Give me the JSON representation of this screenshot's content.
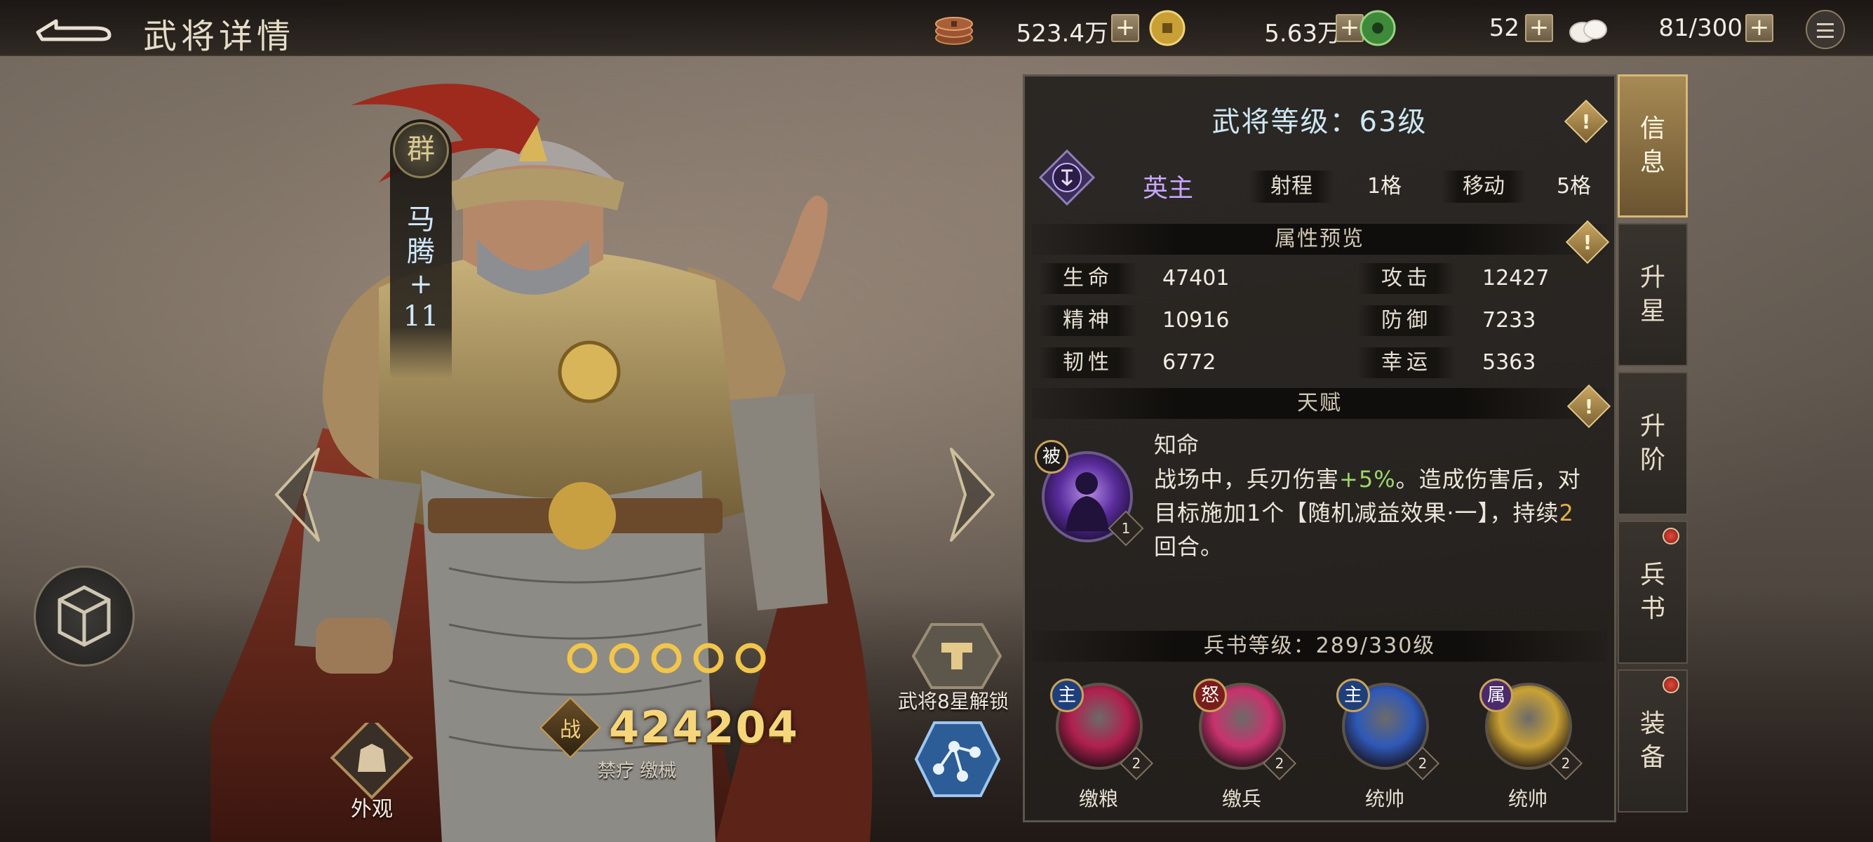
{
  "header": {
    "title": "武将详情"
  },
  "resources": [
    {
      "name": "copper-coins",
      "icon": "copper-coin-stack-icon",
      "value": "523.4万"
    },
    {
      "name": "gold-coin",
      "icon": "gold-coin-icon",
      "value": "5.63万"
    },
    {
      "name": "jade",
      "icon": "jade-coin-icon",
      "value": "52"
    },
    {
      "name": "stamina",
      "icon": "steamed-bun-icon",
      "value": "81/300"
    }
  ],
  "hero": {
    "faction": "群",
    "name": "马腾",
    "plus": "+",
    "rank": "11",
    "star_count": 5,
    "power_icon_label": "战",
    "power": "424204",
    "tags": "禁疗 缴械",
    "appearance_label": "外观",
    "unlock_label": "武将8星解锁"
  },
  "panel": {
    "level_title": "武将等级：63级",
    "class_name": "英主",
    "range_label": "射程",
    "range_value": "1格",
    "move_label": "移动",
    "move_value": "5格",
    "attr_header": "属性预览",
    "stats": [
      {
        "label": "生命",
        "value": "47401"
      },
      {
        "label": "攻击",
        "value": "12427"
      },
      {
        "label": "精神",
        "value": "10916"
      },
      {
        "label": "防御",
        "value": "7233"
      },
      {
        "label": "韧性",
        "value": "6772"
      },
      {
        "label": "幸运",
        "value": "5363"
      }
    ],
    "talent_header": "天赋",
    "talent": {
      "tag": "被",
      "level": "1",
      "name": "知命",
      "desc_1": "战场中，兵刃伤害",
      "desc_bonus": "+5%",
      "desc_2": "。造成伤害后，对目标施加1个【随机减益效果·一】，持续",
      "desc_turns": "2",
      "desc_3": "回合。"
    },
    "book_header": "兵书等级：289/330级",
    "books": [
      {
        "tag": "主",
        "name": "缴粮",
        "level": "2",
        "color": "#b0204e",
        "tag_color": "#1e3f7a"
      },
      {
        "tag": "怒",
        "name": "缴兵",
        "level": "2",
        "color": "#c8336d",
        "tag_color": "#7a1c1c"
      },
      {
        "tag": "主",
        "name": "统帅",
        "level": "2",
        "color": "#2f59b8",
        "tag_color": "#1e3f7a"
      },
      {
        "tag": "属",
        "name": "统帅",
        "level": "2",
        "color": "#c9a235",
        "tag_color": "#4a2a6a"
      }
    ]
  },
  "tabs": [
    {
      "label": "信息",
      "active": true,
      "badge": false
    },
    {
      "label": "升星",
      "active": false,
      "badge": false
    },
    {
      "label": "升阶",
      "active": false,
      "badge": false
    },
    {
      "label": "兵书",
      "active": false,
      "badge": true
    },
    {
      "label": "装备",
      "active": false,
      "badge": true
    }
  ],
  "colors": {
    "accent_gold": "#d6b878",
    "class_purple": "#c9a6ff",
    "level_text": "#cde7f2",
    "bonus_green": "#9cd86a",
    "power_gold": "#f6d67a"
  }
}
